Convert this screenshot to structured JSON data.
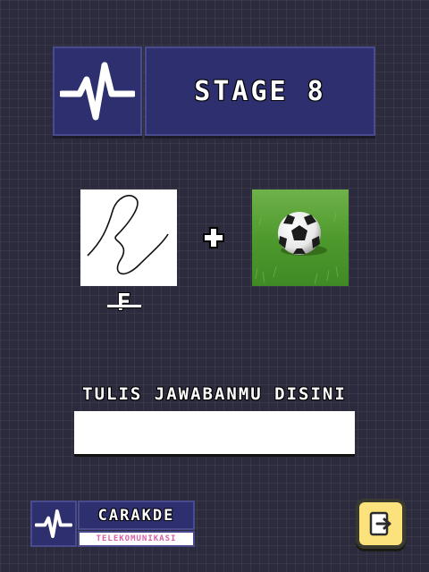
{
  "header": {
    "logo_icon": "pulse-wave-icon",
    "stage_title": "STAGE 8"
  },
  "puzzle": {
    "left_clue_image": "scribble-signature-drawing",
    "operator_icon": "plus-icon",
    "right_clue_image": "soccer-ball-on-grass-photo",
    "letter_hint": "F"
  },
  "answer": {
    "label": "TULIS JAWABANMU DISINI",
    "value": "",
    "placeholder": ""
  },
  "brand": {
    "name": "CARAKDE",
    "subtitle": "TELEKOMUNIKASI",
    "icon": "pulse-wave-icon"
  },
  "controls": {
    "exit_icon": "exit-door-icon"
  },
  "colors": {
    "background": "#2b2b3d",
    "panel": "#2e2f6e",
    "panel_border": "#4a4b8e",
    "exit_button": "#fbe27c",
    "brand_subtitle": "#d65ea8"
  }
}
